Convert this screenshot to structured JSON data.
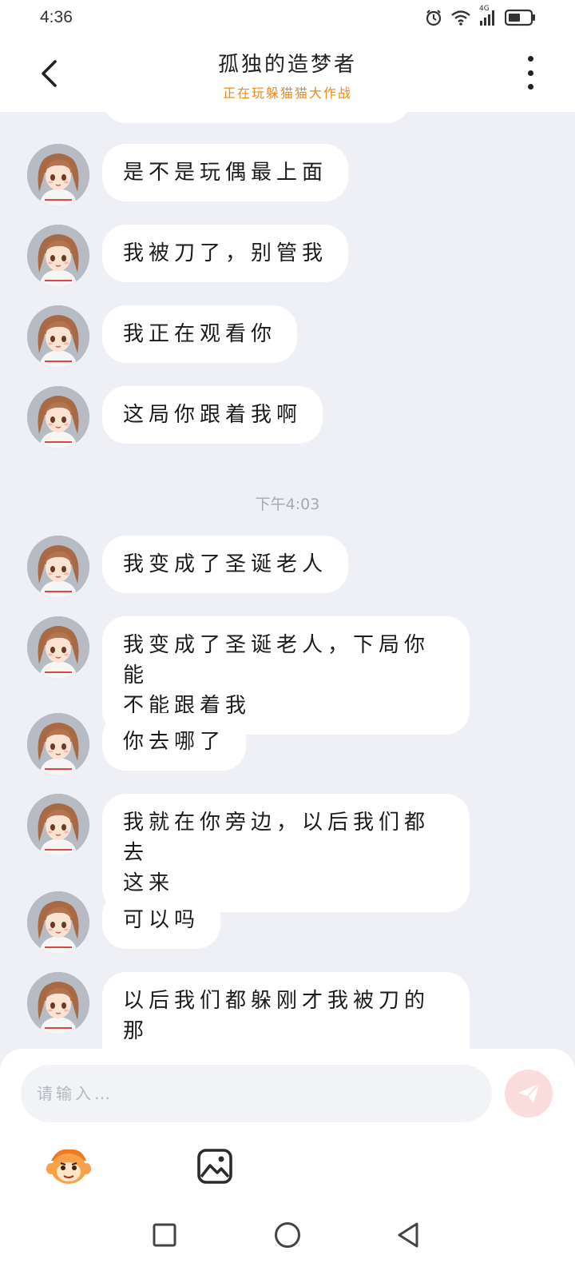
{
  "status_bar": {
    "time": "4:36",
    "network": "4G"
  },
  "header": {
    "title": "孤独的造梦者",
    "subtitle": "正在玩躲猫猫大作战"
  },
  "messages": [
    {
      "text": "是不是玩偶最上面"
    },
    {
      "text": "我被刀了，别管我"
    },
    {
      "text": "我正在观看你"
    },
    {
      "text": "这局你跟着我啊"
    },
    {
      "text": "我变成了圣诞老人"
    },
    {
      "text": "我变成了圣诞老人，下局你能\n不能跟着我"
    },
    {
      "text": "你去哪了"
    },
    {
      "text": "我就在你旁边，以后我们都去\n这来"
    },
    {
      "text": "可以吗"
    },
    {
      "text": "以后我们都躲刚才我被刀的那\n个地方"
    }
  ],
  "time_separator": "下午4:03",
  "input": {
    "placeholder": "请输入…"
  },
  "colors": {
    "background": "#eef0f6",
    "subtitle": "#ef8a1c",
    "send_button": "#fbdcdc",
    "bubble": "#ffffff"
  },
  "icons": {
    "back": "chevron-left-icon",
    "more": "more-vertical-icon",
    "send": "send-icon",
    "emoji": "emoji-face-icon",
    "image": "image-icon",
    "nav_recent": "square-icon",
    "nav_home": "circle-icon",
    "nav_back": "triangle-back-icon"
  }
}
